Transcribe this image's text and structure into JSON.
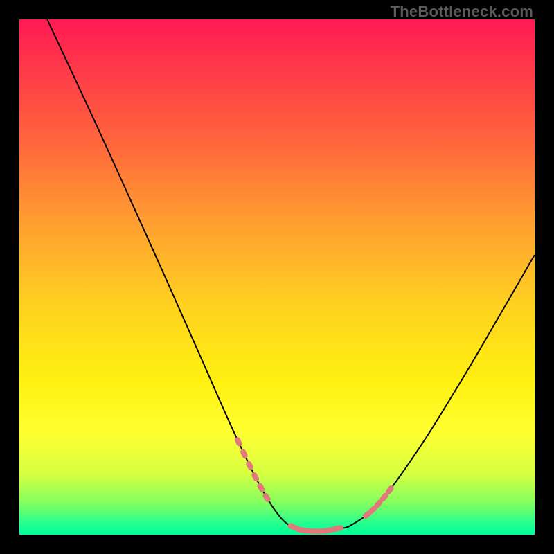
{
  "watermark": "TheBottleneck.com",
  "colors": {
    "background": "#000000",
    "curve": "#000000",
    "marker": "#e07a7a"
  },
  "chart_data": {
    "type": "line",
    "title": "",
    "xlabel": "",
    "ylabel": "",
    "xlim": [
      0,
      100
    ],
    "ylim": [
      0,
      100
    ],
    "grid": false,
    "legend": false,
    "series": [
      {
        "name": "bottleneck-curve",
        "x": [
          5.4,
          16.1,
          26.9,
          34.9,
          41.5,
          46.8,
          50.8,
          53.8,
          56.5,
          59.1,
          61.8,
          64.5,
          69.9,
          77.8,
          86.2,
          93.0,
          100.0
        ],
        "y": [
          100.0,
          77.0,
          53.1,
          35.1,
          20.2,
          9.3,
          3.2,
          1.2,
          0.7,
          0.7,
          1.2,
          1.9,
          6.2,
          17.1,
          30.6,
          42.2,
          54.3
        ]
      }
    ],
    "annotations": {
      "marker_segments_x": [
        [
          42.5,
          48.9
        ],
        [
          53.0,
          62.4
        ],
        [
          67.5,
          72.3
        ]
      ]
    }
  }
}
